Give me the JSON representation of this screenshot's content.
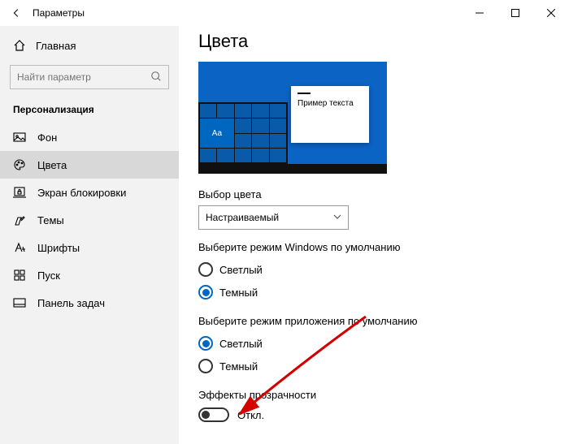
{
  "titlebar": {
    "title": "Параметры"
  },
  "sidebar": {
    "home": "Главная",
    "search_placeholder": "Найти параметр",
    "section": "Персонализация",
    "items": [
      {
        "label": "Фон"
      },
      {
        "label": "Цвета"
      },
      {
        "label": "Экран блокировки"
      },
      {
        "label": "Темы"
      },
      {
        "label": "Шрифты"
      },
      {
        "label": "Пуск"
      },
      {
        "label": "Панель задач"
      }
    ]
  },
  "main": {
    "title": "Цвета",
    "preview": {
      "sample_text": "Пример текста",
      "tile_label": "Aa"
    },
    "color_choice": {
      "label": "Выбор цвета",
      "value": "Настраиваемый"
    },
    "windows_mode": {
      "label": "Выберите режим Windows по умолчанию",
      "option_light": "Светлый",
      "option_dark": "Темный",
      "selected": "dark"
    },
    "app_mode": {
      "label": "Выберите режим приложения по умолчанию",
      "option_light": "Светлый",
      "option_dark": "Темный",
      "selected": "light"
    },
    "transparency": {
      "label": "Эффекты прозрачности",
      "state": "Откл."
    }
  }
}
